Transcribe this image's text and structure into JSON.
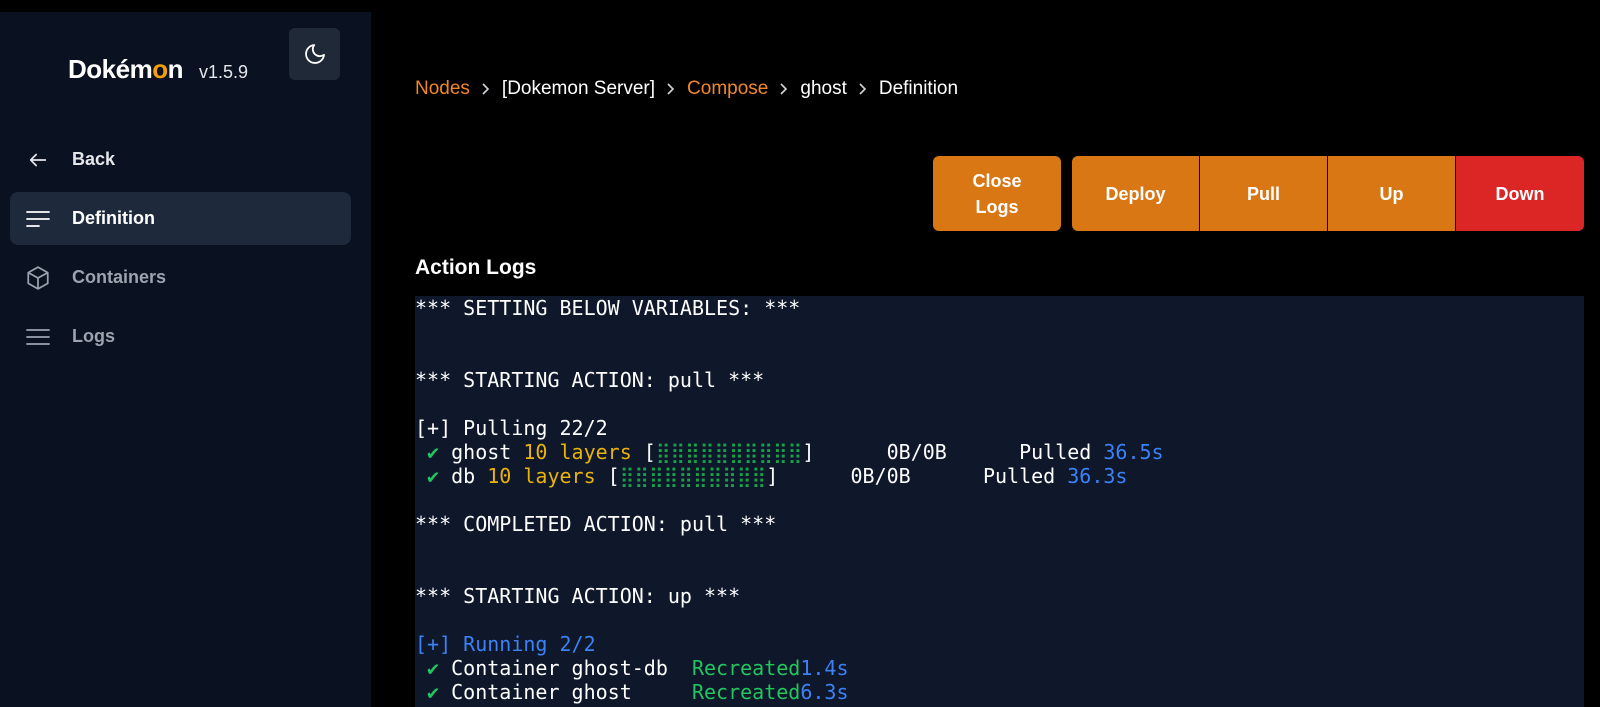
{
  "brand": {
    "name_prefix": "Dok",
    "name_e": "é",
    "name_m": "m",
    "name_o": "o",
    "name_suffix": "n",
    "version": "v1.5.9"
  },
  "sidebar": {
    "items": [
      {
        "label": "Back",
        "icon": "arrow-left-icon"
      },
      {
        "label": "Definition",
        "icon": "menu-lines-icon",
        "active": true
      },
      {
        "label": "Containers",
        "icon": "cube-icon"
      },
      {
        "label": "Logs",
        "icon": "list-icon"
      }
    ]
  },
  "breadcrumb": {
    "nodes": "Nodes",
    "server": "[Dokemon Server]",
    "compose": "Compose",
    "project": "ghost",
    "current": "Definition"
  },
  "actions": {
    "close_logs": "Close Logs",
    "deploy": "Deploy",
    "pull": "Pull",
    "up": "Up",
    "down": "Down"
  },
  "logs": {
    "title": "Action Logs",
    "setting_vars": "*** SETTING BELOW VARIABLES: ***",
    "start_pull": "*** STARTING ACTION: pull ***",
    "pulling": "[+] Pulling 22/2",
    "check": " ✔ ",
    "ghost_name": "ghost ",
    "ghost_layers": "10 layers",
    "ghost_bar": "⣿⣿⣿⣿⣿⣿⣿⣿⣿⣿",
    "ghost_size": "      0B/0B      ",
    "ghost_status": "Pulled ",
    "ghost_time": "36.5s",
    "db_name": "db ",
    "db_layers": "10 layers",
    "db_bar": "⣿⣿⣿⣿⣿⣿⣿⣿⣿⣿",
    "db_size": "      0B/0B      ",
    "db_status": "Pulled ",
    "db_time": "36.3s",
    "complete_pull": "*** COMPLETED ACTION: pull ***",
    "start_up": "*** STARTING ACTION: up ***",
    "running": "[+] Running 2/2",
    "c1_name": "Container ghost-db  ",
    "c1_status": "Recreated",
    "c1_time": "1.4s",
    "c2_name": "Container ghost     ",
    "c2_status": "Recreated",
    "c2_time": "6.3s"
  },
  "colors": {
    "accent": "#d97715",
    "danger": "#dc2626",
    "link": "#f0882a",
    "log_bg": "#0f172a",
    "sidebar_bg": "#0a1222"
  }
}
